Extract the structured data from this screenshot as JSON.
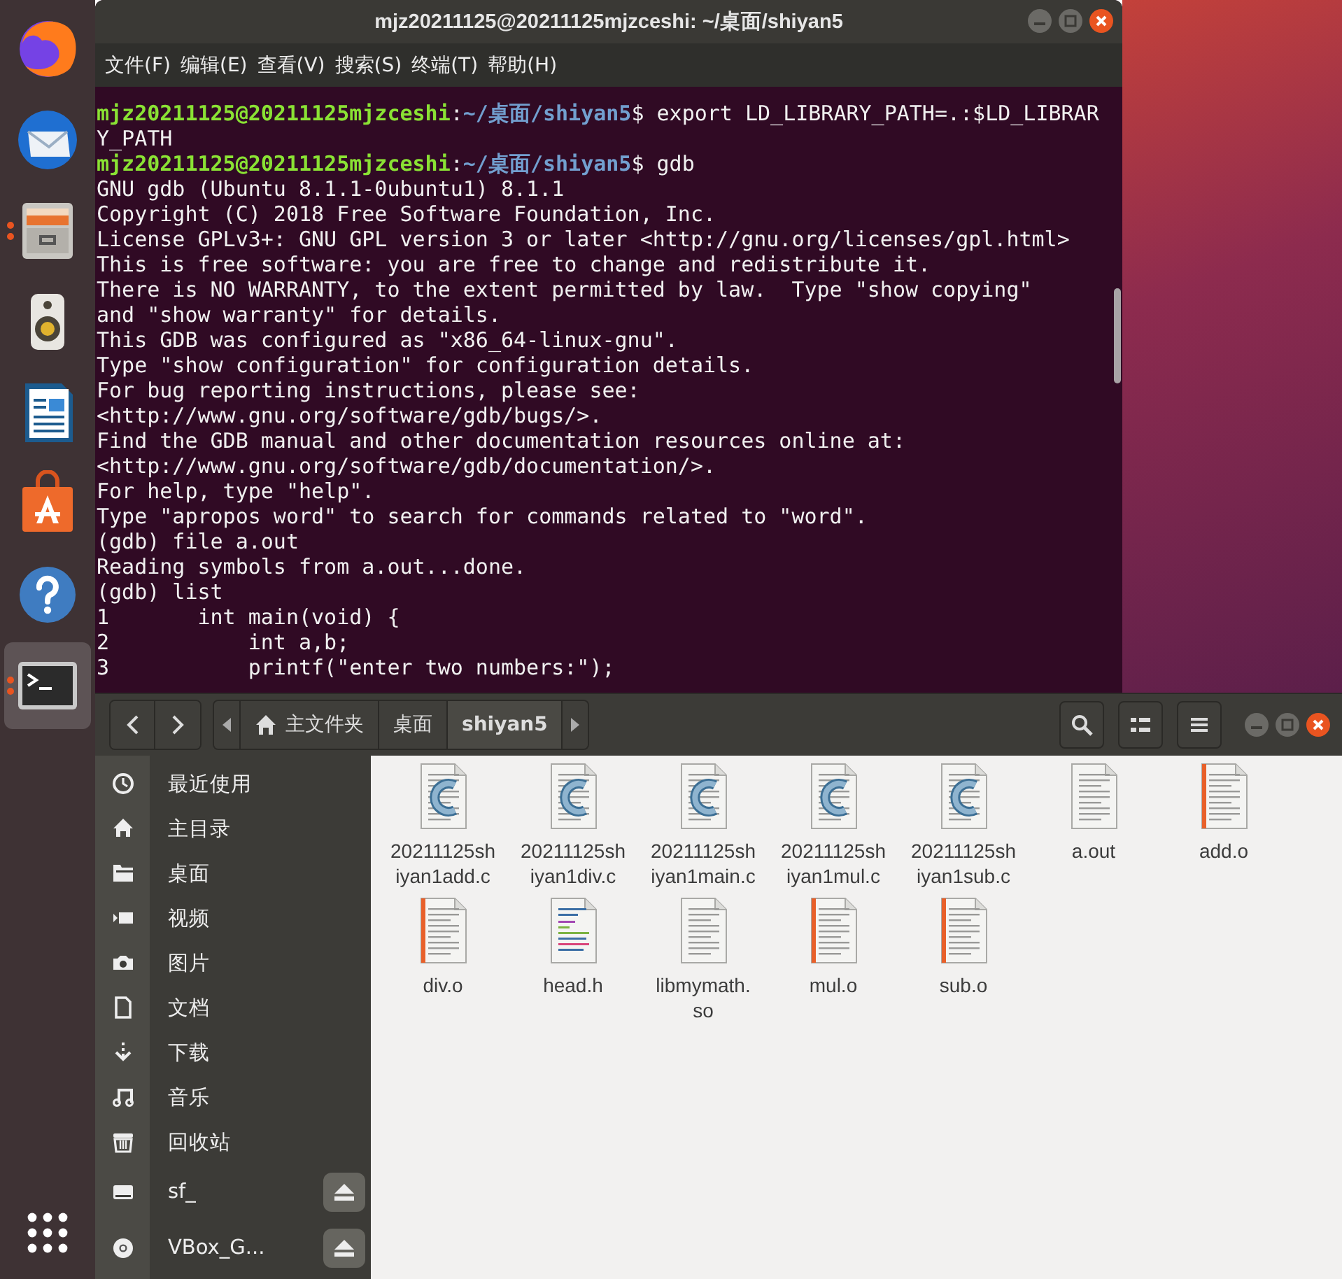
{
  "dock": {
    "items": [
      {
        "kind": "browser",
        "running": false,
        "selected": false
      },
      {
        "kind": "mail",
        "running": false,
        "selected": false
      },
      {
        "kind": "files",
        "running": true,
        "selected": false
      },
      {
        "kind": "music",
        "running": false,
        "selected": false
      },
      {
        "kind": "writer",
        "running": false,
        "selected": false
      },
      {
        "kind": "store",
        "running": false,
        "selected": false
      },
      {
        "kind": "help",
        "running": false,
        "selected": false
      },
      {
        "kind": "terminal",
        "running": true,
        "selected": true
      }
    ]
  },
  "terminal": {
    "title": "mjz20211125@20211125mjzceshi: ~/桌面/shiyan5",
    "menu": [
      "文件(F)",
      "编辑(E)",
      "查看(V)",
      "搜索(S)",
      "终端(T)",
      "帮助(H)"
    ],
    "lines": [
      {
        "kind": "prompt",
        "user": "mjz20211125@20211125mjzceshi",
        "sep": ":",
        "path": "~/桌面/shiyan5",
        "input": "$ export LD_LIBRARY_PATH=.:$LD_LIBRAR"
      },
      {
        "kind": "output",
        "text": "Y_PATH"
      },
      {
        "kind": "prompt",
        "user": "mjz20211125@20211125mjzceshi",
        "sep": ":",
        "path": "~/桌面/shiyan5",
        "input": "$ gdb"
      },
      {
        "kind": "output",
        "text": "GNU gdb (Ubuntu 8.1.1-0ubuntu1) 8.1.1"
      },
      {
        "kind": "output",
        "text": "Copyright (C) 2018 Free Software Foundation, Inc."
      },
      {
        "kind": "output",
        "text": "License GPLv3+: GNU GPL version 3 or later <http://gnu.org/licenses/gpl.html>"
      },
      {
        "kind": "output",
        "text": "This is free software: you are free to change and redistribute it."
      },
      {
        "kind": "output",
        "text": "There is NO WARRANTY, to the extent permitted by law.  Type \"show copying\""
      },
      {
        "kind": "output",
        "text": "and \"show warranty\" for details."
      },
      {
        "kind": "output",
        "text": "This GDB was configured as \"x86_64-linux-gnu\"."
      },
      {
        "kind": "output",
        "text": "Type \"show configuration\" for configuration details."
      },
      {
        "kind": "output",
        "text": "For bug reporting instructions, please see:"
      },
      {
        "kind": "output",
        "text": "<http://www.gnu.org/software/gdb/bugs/>."
      },
      {
        "kind": "output",
        "text": "Find the GDB manual and other documentation resources online at:"
      },
      {
        "kind": "output",
        "text": "<http://www.gnu.org/software/gdb/documentation/>."
      },
      {
        "kind": "output",
        "text": "For help, type \"help\"."
      },
      {
        "kind": "output",
        "text": "Type \"apropos word\" to search for commands related to \"word\"."
      },
      {
        "kind": "output",
        "text": "(gdb) file a.out"
      },
      {
        "kind": "output",
        "text": "Reading symbols from a.out...done."
      },
      {
        "kind": "output",
        "text": "(gdb) list"
      },
      {
        "kind": "output",
        "text": "1       int main(void) {"
      },
      {
        "kind": "output",
        "text": "2           int a,b;"
      },
      {
        "kind": "output",
        "text": "3           printf(\"enter two numbers:\");"
      }
    ]
  },
  "files_window": {
    "path": [
      {
        "kind": "home",
        "label": "主文件夹",
        "selected": false
      },
      {
        "kind": "folder",
        "label": "桌面",
        "selected": false
      },
      {
        "kind": "folder",
        "label": "shiyan5",
        "selected": true
      }
    ],
    "sidebar": [
      {
        "kind": "recent",
        "label": "最近使用",
        "ejectable": false
      },
      {
        "kind": "home",
        "label": "主目录",
        "ejectable": false
      },
      {
        "kind": "desktop",
        "label": "桌面",
        "ejectable": false
      },
      {
        "kind": "videos",
        "label": "视频",
        "ejectable": false
      },
      {
        "kind": "pictures",
        "label": "图片",
        "ejectable": false
      },
      {
        "kind": "documents",
        "label": "文档",
        "ejectable": false
      },
      {
        "kind": "downloads",
        "label": "下载",
        "ejectable": false
      },
      {
        "kind": "music",
        "label": "音乐",
        "ejectable": false
      },
      {
        "kind": "trash",
        "label": "回收站",
        "ejectable": false
      },
      {
        "kind": "drive",
        "label": "sf_",
        "ejectable": true
      },
      {
        "kind": "disc",
        "label": "VBox_G...",
        "ejectable": true
      }
    ],
    "files": [
      {
        "kind": "c",
        "label": [
          "20211125sh",
          "iyan1add.c"
        ]
      },
      {
        "kind": "c",
        "label": [
          "20211125sh",
          "iyan1div.c"
        ]
      },
      {
        "kind": "c",
        "label": [
          "20211125sh",
          "iyan1main.c"
        ]
      },
      {
        "kind": "c",
        "label": [
          "20211125sh",
          "iyan1mul.c"
        ]
      },
      {
        "kind": "c",
        "label": [
          "20211125sh",
          "iyan1sub.c"
        ]
      },
      {
        "kind": "text",
        "label": [
          "a.out"
        ]
      },
      {
        "kind": "object",
        "label": [
          "add.o"
        ]
      },
      {
        "kind": "object",
        "label": [
          "div.o"
        ]
      },
      {
        "kind": "header",
        "label": [
          "head.h"
        ]
      },
      {
        "kind": "text",
        "label": [
          "libmymath.",
          "so"
        ]
      },
      {
        "kind": "object",
        "label": [
          "mul.o"
        ]
      },
      {
        "kind": "object",
        "label": [
          "sub.o"
        ]
      }
    ]
  }
}
